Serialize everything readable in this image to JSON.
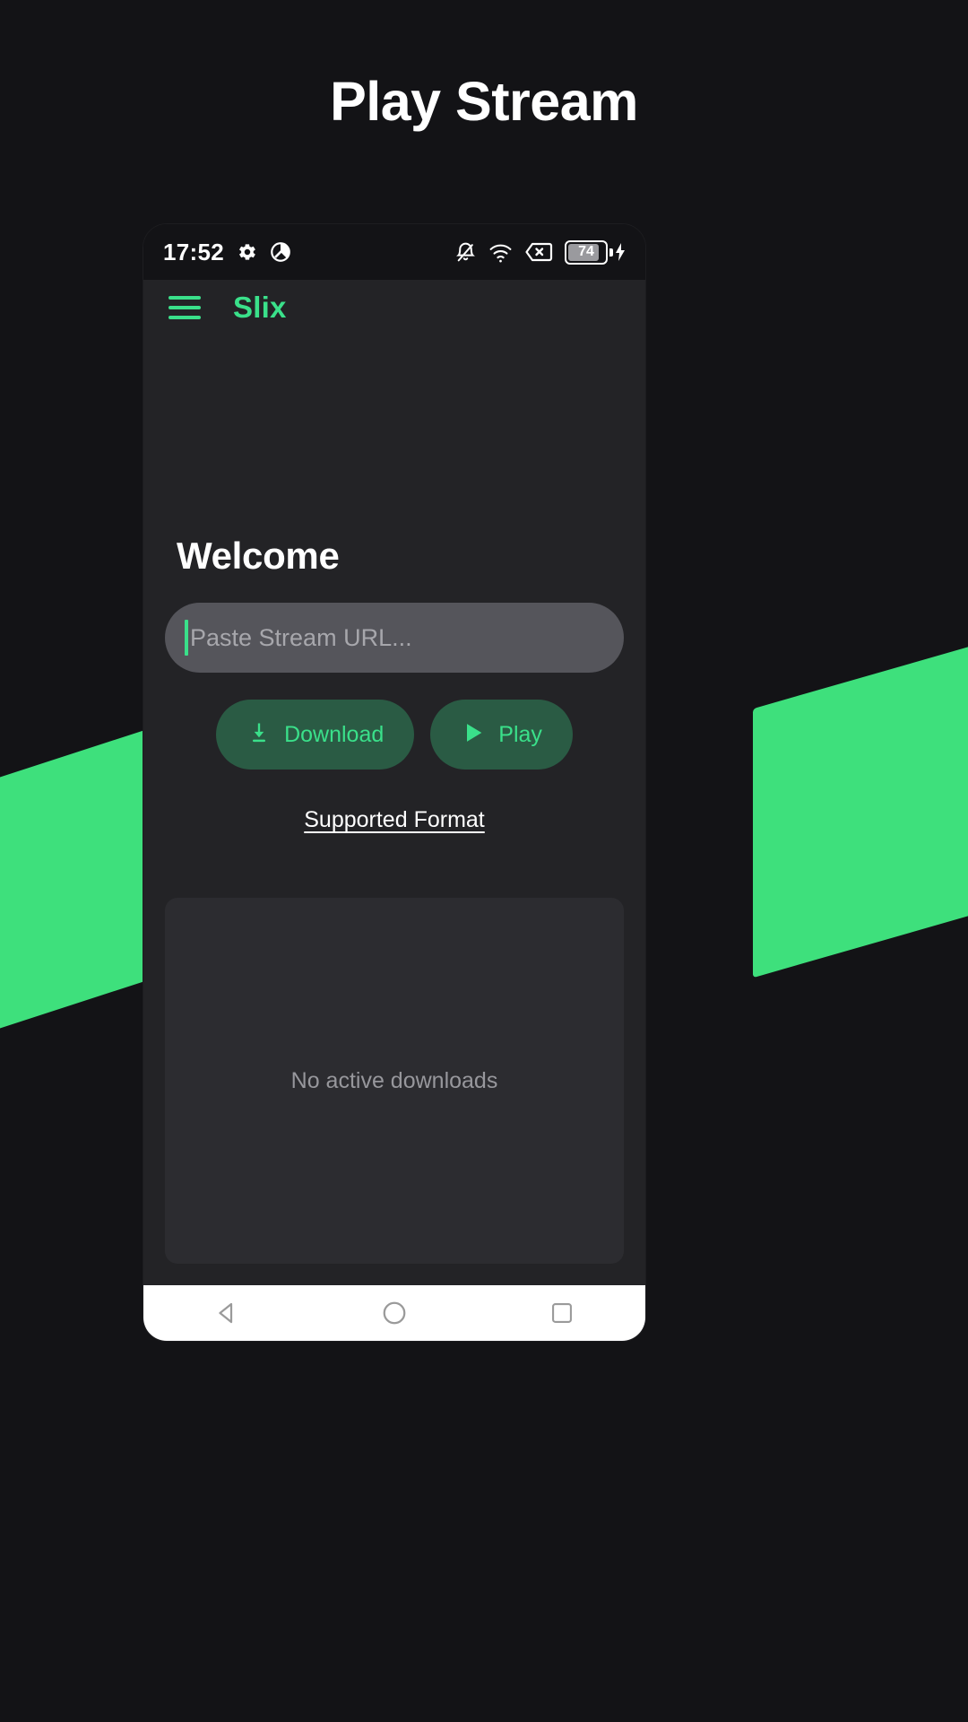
{
  "page": {
    "title": "Play Stream",
    "background_color": "#131316",
    "accent_color": "#3ae08a",
    "ribbon_color": "#3ee07c"
  },
  "phone": {
    "statusbar": {
      "time": "17:52",
      "left_icons": [
        "gear-icon",
        "do-not-disturb-icon"
      ],
      "right_icons": [
        "bell-off-icon",
        "wifi-icon",
        "sim-card-off-icon"
      ],
      "battery": {
        "level": "74",
        "charging": true
      }
    },
    "appbar": {
      "menu_icon": "hamburger-menu-icon",
      "brand": "Slix"
    },
    "main": {
      "heading": "Welcome",
      "url_input": {
        "value": "",
        "placeholder": "Paste Stream URL..."
      },
      "buttons": [
        {
          "label": "Download",
          "icon": "download-icon"
        },
        {
          "label": "Play",
          "icon": "play-icon"
        }
      ],
      "supported_link": "Supported Format",
      "downloads_panel": {
        "empty_text": "No active downloads"
      }
    },
    "navbar": {
      "back": "back-triangle-icon",
      "home": "home-circle-icon",
      "recents": "recents-square-icon"
    }
  }
}
